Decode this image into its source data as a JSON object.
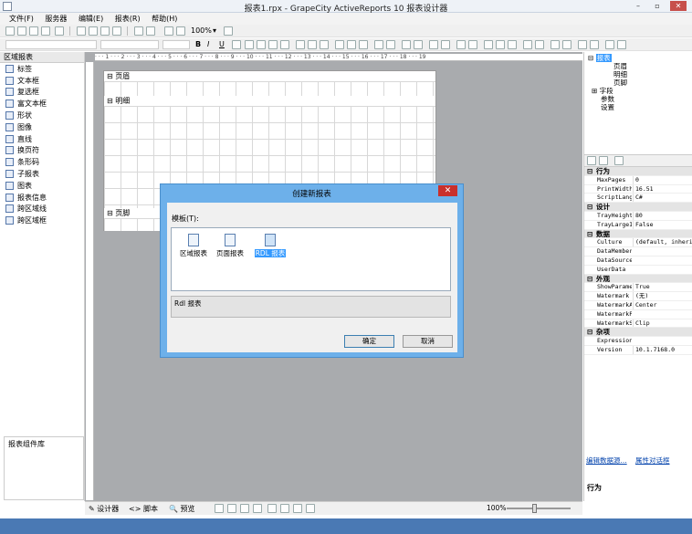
{
  "window": {
    "title": "报表1.rpx - GrapeCity ActiveReports 10 报表设计器",
    "minimize": "–",
    "maximize": "▫",
    "close": "✕"
  },
  "menu": [
    "文件(F)",
    "服务器",
    "编辑(E)",
    "报表(R)",
    "帮助(H)"
  ],
  "toolbar": {
    "zoom": "100%",
    "font_bold": "B",
    "font_italic": "I",
    "font_underline": "U"
  },
  "toolbox": {
    "header": "区域报表",
    "items": [
      "标签",
      "文本框",
      "复选框",
      "富文本框",
      "形状",
      "图像",
      "直线",
      "换页符",
      "条形码",
      "子报表",
      "图表",
      "报表信息",
      "跨区域线",
      "跨区域框"
    ],
    "component_library": "报表组件库"
  },
  "ruler": "· · · 1 · · · 2 · · · 3 · · · 4 · · · 5 · · · 6 · · · 7 · · · 8 · · · 9 · · · 10 · · · 11 · · · 12 · · · 13 · · · 14 · · · 15 · · · 16 · · · 17 · · · 18 · · · 19",
  "report": {
    "bands": [
      "页眉",
      "明细",
      "页脚"
    ]
  },
  "dialog": {
    "title": "创建新报表",
    "templates_label": "模板(T):",
    "templates": [
      "区域报表",
      "页面报表",
      "RDL 报表"
    ],
    "selected_template": "RDL 报表",
    "description": "Rdl 报表",
    "ok": "确定",
    "cancel": "取消"
  },
  "explorer": {
    "root": "报表",
    "children": [
      "页眉",
      "明细",
      "页脚"
    ],
    "others": [
      "字段",
      "参数",
      "设置"
    ]
  },
  "properties": [
    {
      "cat": "行为"
    },
    {
      "k": "MaxPages",
      "v": "0"
    },
    {
      "k": "PrintWidth",
      "v": "16.51"
    },
    {
      "k": "ScriptLanguage",
      "v": "C#"
    },
    {
      "cat": "设计"
    },
    {
      "k": "TrayHeight",
      "v": "80"
    },
    {
      "k": "TrayLargeIcons",
      "v": "False"
    },
    {
      "cat": "数据"
    },
    {
      "k": "Culture",
      "v": "(default, inherit)"
    },
    {
      "k": "DataMember",
      "v": ""
    },
    {
      "k": "DataSource",
      "v": ""
    },
    {
      "k": "UserData",
      "v": ""
    },
    {
      "cat": "外观"
    },
    {
      "k": "ShowParameterUI",
      "v": "True"
    },
    {
      "k": "Watermark",
      "v": "(无)"
    },
    {
      "k": "WatermarkAlignment",
      "v": "Center"
    },
    {
      "k": "WatermarkPrintOnPages",
      "v": ""
    },
    {
      "k": "WatermarkSizeMode",
      "v": "Clip"
    },
    {
      "cat": "杂项"
    },
    {
      "k": "Expression",
      "v": ""
    },
    {
      "k": "Version",
      "v": "10.1.7168.0"
    }
  ],
  "links": {
    "edit_data_source": "编辑数据源...",
    "property_dialog": "属性对话框"
  },
  "property_desc": "行为",
  "status": {
    "designer_tab": "设计器",
    "script_tab": "脚本",
    "preview_tab": "预览",
    "zoom": "100%"
  }
}
